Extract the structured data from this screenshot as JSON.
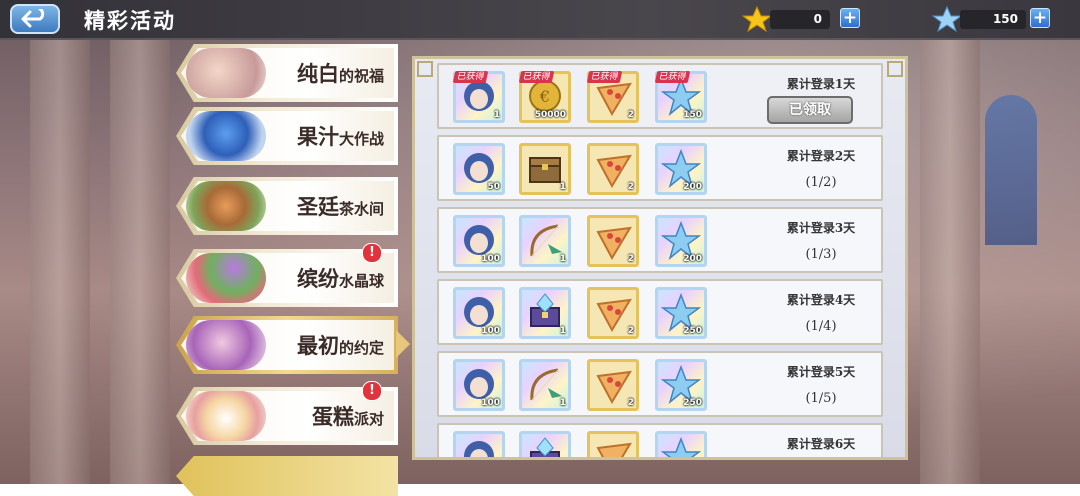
{
  "header": {
    "title": "精彩活动",
    "currency_star": "0",
    "currency_crystal": "150"
  },
  "events": [
    {
      "big": "纯白",
      "small": "的祝福",
      "alert": false
    },
    {
      "big": "果汁",
      "small": "大作战",
      "alert": false
    },
    {
      "big": "圣廷",
      "small": "茶水间",
      "alert": false
    },
    {
      "big": "缤纷",
      "small": "水晶球",
      "alert": true
    },
    {
      "big": "最初",
      "small": "的约定",
      "alert": false,
      "active": true
    },
    {
      "big": "蛋糕",
      "small": "派对",
      "alert": true
    }
  ],
  "alert_mark": "!",
  "rewards": [
    {
      "day": "累计登录1天",
      "progress": "",
      "button": "已领取",
      "items": [
        {
          "kind": "portrait",
          "qty": "1",
          "got": "已获得"
        },
        {
          "kind": "coin",
          "qty": "50000",
          "got": "已获得"
        },
        {
          "kind": "pizza",
          "qty": "2",
          "got": "已获得"
        },
        {
          "kind": "star",
          "qty": "150",
          "got": "已获得"
        }
      ]
    },
    {
      "day": "累计登录2天",
      "progress": "(1/2)",
      "items": [
        {
          "kind": "portrait",
          "qty": "50"
        },
        {
          "kind": "chest",
          "qty": "1"
        },
        {
          "kind": "pizza",
          "qty": "2"
        },
        {
          "kind": "star",
          "qty": "200"
        }
      ]
    },
    {
      "day": "累计登录3天",
      "progress": "(1/3)",
      "items": [
        {
          "kind": "portrait",
          "qty": "100"
        },
        {
          "kind": "bow",
          "qty": "1"
        },
        {
          "kind": "pizza",
          "qty": "2"
        },
        {
          "kind": "star",
          "qty": "200"
        }
      ]
    },
    {
      "day": "累计登录4天",
      "progress": "(1/4)",
      "items": [
        {
          "kind": "portrait",
          "qty": "100"
        },
        {
          "kind": "gem-box",
          "qty": "1"
        },
        {
          "kind": "pizza",
          "qty": "2"
        },
        {
          "kind": "star",
          "qty": "250"
        }
      ]
    },
    {
      "day": "累计登录5天",
      "progress": "(1/5)",
      "items": [
        {
          "kind": "portrait",
          "qty": "100"
        },
        {
          "kind": "bow",
          "qty": "1"
        },
        {
          "kind": "pizza",
          "qty": "2"
        },
        {
          "kind": "star",
          "qty": "250"
        }
      ]
    },
    {
      "day": "累计登录6天",
      "progress": "",
      "items": [
        {
          "kind": "portrait",
          "qty": ""
        },
        {
          "kind": "gem-box",
          "qty": ""
        },
        {
          "kind": "pizza",
          "qty": ""
        },
        {
          "kind": "star",
          "qty": ""
        }
      ]
    }
  ],
  "colors": {
    "accent_blue": "#3d7ac0",
    "gold_border": "#e4c35d",
    "alert_red": "#e2323c",
    "got_tag": "#d8344e"
  }
}
